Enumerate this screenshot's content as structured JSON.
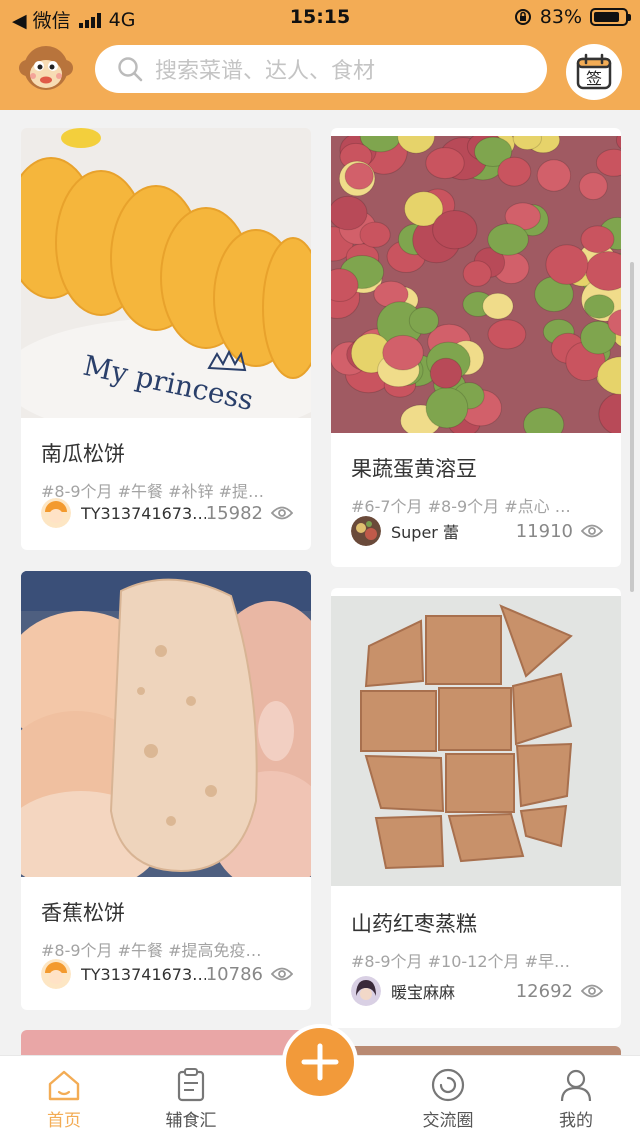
{
  "status_bar": {
    "back_label": "◀ 微信",
    "network": "4G",
    "time": "15:15",
    "battery_text": "83%",
    "battery_level": 0.83
  },
  "header": {
    "search_placeholder": "搜索菜谱、达人、食材",
    "signin_label": "签"
  },
  "feed": [
    {
      "title": "南瓜松饼",
      "tags": "#8-9个月  #午餐  #补锌  #提…",
      "username": "TY313741673…",
      "views": "15982",
      "image_text": "My princess"
    },
    {
      "title": "果蔬蛋黄溶豆",
      "tags": "#6-7个月  #8-9个月  #点心  …",
      "username": "Super 蕾",
      "views": "11910"
    },
    {
      "title": "香蕉松饼",
      "tags": "#8-9个月  #午餐  #提高免疫…",
      "username": "TY313741673…",
      "views": "10786"
    },
    {
      "title": "山药红枣蒸糕",
      "tags": "#8-9个月  #10-12个月  #早…",
      "username": "暖宝麻麻",
      "views": "12692"
    }
  ],
  "bottom_nav": {
    "home": "首页",
    "recipes": "辅食汇",
    "community": "交流圈",
    "mine": "我的"
  },
  "colors": {
    "brand": "#f3ac55",
    "fab": "#f29a3a"
  }
}
